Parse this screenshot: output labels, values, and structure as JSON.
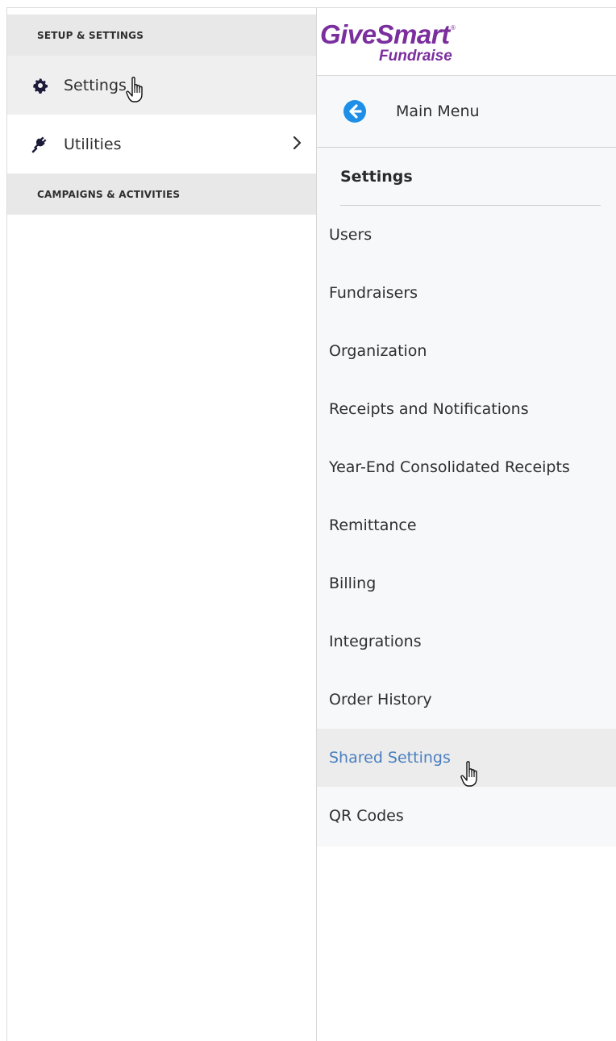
{
  "left_nav": {
    "section_setup": "SETUP & SETTINGS",
    "items": [
      {
        "label": "Settings",
        "icon": "gear-icon"
      },
      {
        "label": "Utilities",
        "icon": "plug-icon"
      }
    ],
    "section_campaigns": "CAMPAIGNS & ACTIVITIES"
  },
  "brand": {
    "name": "GiveSmart",
    "sub": "Fundraise",
    "reg": "®",
    "color": "#7b2e9e"
  },
  "submenu": {
    "back_label": "Main Menu",
    "title": "Settings",
    "items": [
      "Users",
      "Fundraisers",
      "Organization",
      "Receipts and Notifications",
      "Year-End Consolidated Receipts",
      "Remittance",
      "Billing",
      "Integrations",
      "Order History",
      "Shared Settings",
      "QR Codes"
    ],
    "active_item": "Shared Settings",
    "active_color": "#4a7fc0"
  }
}
